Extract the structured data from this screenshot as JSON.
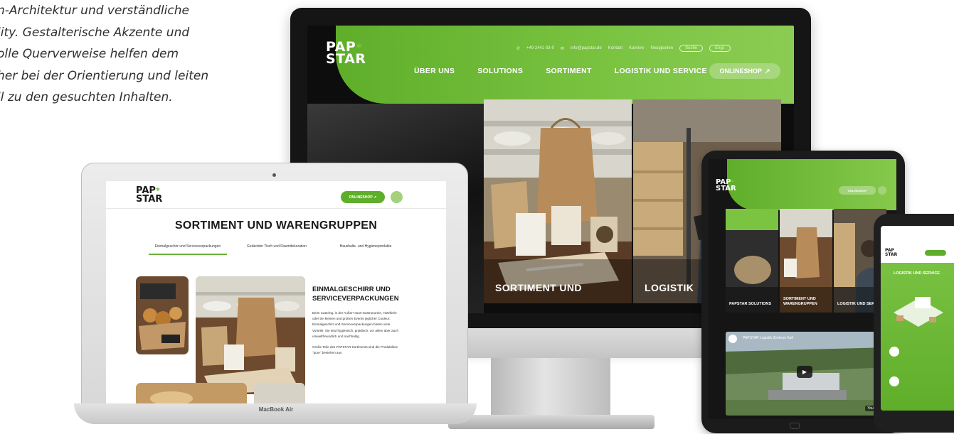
{
  "intro": {
    "lines": [
      "n-Architektur und verständliche",
      "lity. Gestalterische Akzente und",
      "olle Querverweise helfen dem",
      "her bei der Orientierung und leiten",
      "ll zu den gesuchten Inhalten."
    ]
  },
  "desktop": {
    "logo_line1": "PAP",
    "logo_star": "*",
    "logo_line2": "STAR",
    "phone": "+49 2441 83-0",
    "email": "info@papstar.de",
    "top_links": [
      "Kontakt",
      "Karriere",
      "Neuigkeiten"
    ],
    "search_placeholder": "Suche",
    "language": "Engl.",
    "nav": [
      "ÜBER UNS",
      "SOLUTIONS",
      "SORTIMENT",
      "LOGISTIK UND SERVICE"
    ],
    "shop_label": "ONLINESHOP",
    "shop_icon": "external-link-icon",
    "panels": [
      "SORTIMENT UND",
      "LOGISTIK"
    ]
  },
  "laptop": {
    "logo_line1": "PAP",
    "logo_star": "*",
    "logo_line2": "STAR",
    "shop_label": "ONLINESHOP",
    "heading": "SORTIMENT UND WARENGRUPPEN",
    "tabs": [
      "Einmalgeschirr und Serviceverpackungen",
      "Gedeckter Tisch und Raumdekoration",
      "Haushalts- und Hygieneprodukte"
    ],
    "article_heading": "EINMALGESCHIRR UND SERVICEVERPACKUNGEN",
    "article_p1": "Beim Catering, in der Außer-Haus-Gastronomie, Hotellerie oder bei kleinen und großen Events jeglicher Couleur: Einmalgeschirr und Serviceverpackungen bieten viele Vorteile: Sie sind hygienisch, praktisch, vor allem aber auch umweltfreundlich und nachhaltig.",
    "article_p2": "Große Teile des PAPSTAR Sortiments sind die Produktlinie \"pure\" bestehen aus",
    "brand": "MacBook Air"
  },
  "tablet": {
    "logo_line1": "PAP",
    "logo_star": "*",
    "logo_line2": "STAR",
    "shop_label": "ONLINESHOP",
    "panels": [
      "PAPSTAR SOLUTIONS",
      "SORTIMENT UND WARENGRUPPEN",
      "LOGISTIK UND SERVICE"
    ],
    "video_title": "PAPSTAR Logistik Zentrum Kall",
    "video_brand": "YouTube"
  },
  "phone": {
    "logo_line1": "PAP",
    "logo_line2": "STAR",
    "title": "LOGISTIK UND SERVICE"
  },
  "colors": {
    "brand_green": "#6cb33e",
    "dark": "#151515",
    "text": "#1a1a1a"
  }
}
